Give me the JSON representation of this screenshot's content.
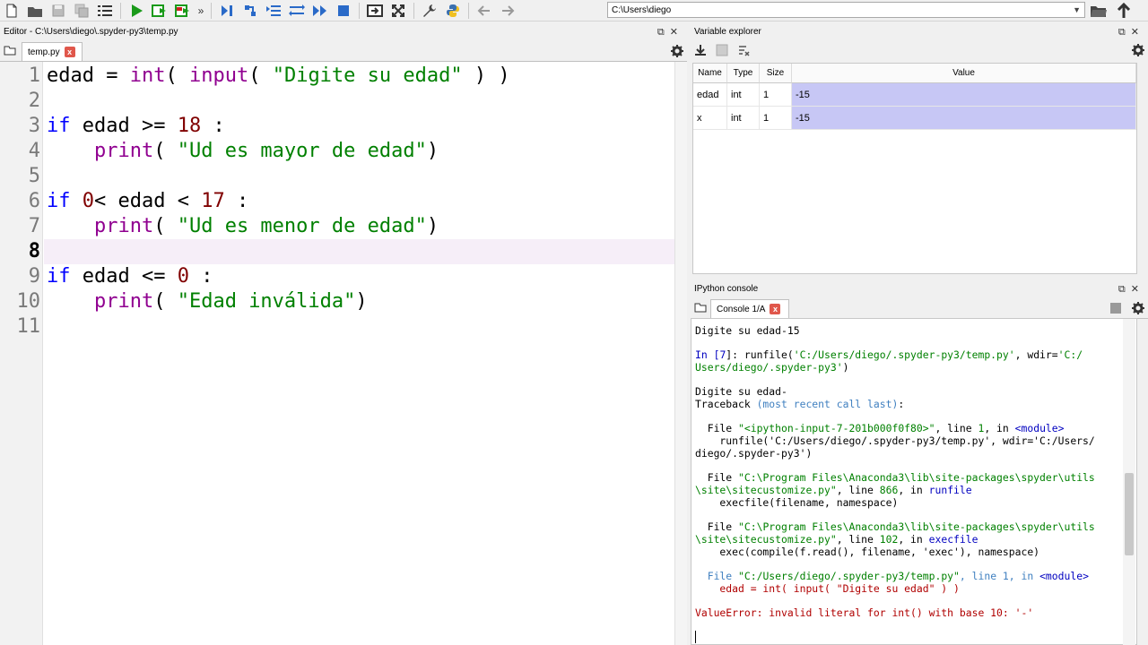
{
  "toolbar": {
    "path": "C:\\Users\\diego",
    "more": "»"
  },
  "editor": {
    "title": "Editor - C:\\Users\\diego\\.spyder-py3\\temp.py",
    "tab_label": "temp.py",
    "tab_close": "x",
    "line_numbers": [
      "1",
      "2",
      "3",
      "4",
      "5",
      "6",
      "7",
      "8",
      "9",
      "10",
      "11"
    ],
    "current_line": "8",
    "code": {
      "l1_a": "edad = ",
      "l1_int": "int",
      "l1_b": "( ",
      "l1_input": "input",
      "l1_c": "( ",
      "l1_str": "\"Digite su edad\"",
      "l1_d": " ) )",
      "l3_if": "if",
      "l3_a": " edad >= ",
      "l3_num": "18",
      "l3_b": " :",
      "l4_ind": "    ",
      "l4_print": "print",
      "l4_a": "( ",
      "l4_str": "\"Ud es mayor de edad\"",
      "l4_b": ")",
      "l6_if": "if",
      "l6_a": " ",
      "l6_num0": "0",
      "l6_b": "< edad < ",
      "l6_num": "17",
      "l6_c": " :",
      "l7_ind": "    ",
      "l7_print": "print",
      "l7_a": "( ",
      "l7_str": "\"Ud es menor de edad\"",
      "l7_b": ")",
      "l9_if": "if",
      "l9_a": " edad <= ",
      "l9_num": "0",
      "l9_b": " :",
      "l10_ind": "    ",
      "l10_print": "print",
      "l10_a": "( ",
      "l10_str": "\"Edad inválida\"",
      "l10_b": ")"
    }
  },
  "variable_explorer": {
    "title": "Variable explorer",
    "columns": [
      "Name",
      "Type",
      "Size",
      "Value"
    ],
    "rows": [
      {
        "name": "edad",
        "type": "int",
        "size": "1",
        "value": "-15"
      },
      {
        "name": "x",
        "type": "int",
        "size": "1",
        "value": "-15"
      }
    ],
    "highlight_color": "#c7c7f5"
  },
  "console": {
    "title": "IPython console",
    "tab_label": "Console 1/A",
    "tab_close": "x",
    "lines": {
      "a1": "Digite su edad-15",
      "b1_in": "In [",
      "b1_n": "7",
      "b1_c": "]: runfile(",
      "b1_s1": "'C:/Users/diego/.spyder-py3/temp.py'",
      "b1_m": ", wdir=",
      "b1_s2": "'C:/",
      "b2": "Users/diego/.spyder-py3'",
      "b2_end": ")",
      "c1": "Digite su edad-",
      "c2_a": "Traceback ",
      "c2_b": "(most recent call last)",
      "c2_c": ":",
      "d1_a": "  File ",
      "d1_s": "\"<ipython-input-7-201b000f0f80>\"",
      "d1_b": ", line ",
      "d1_n": "1",
      "d1_c": ", in ",
      "d1_m": "<module>",
      "d2": "    runfile('C:/Users/diego/.spyder-py3/temp.py', wdir='C:/Users/",
      "d3": "diego/.spyder-py3')",
      "e1_a": "  File ",
      "e1_s": "\"C:\\Program Files\\Anaconda3\\lib\\site-packages\\spyder\\utils",
      "e2_s": "\\site\\sitecustomize.py\"",
      "e2_b": ", line ",
      "e2_n": "866",
      "e2_c": ", in ",
      "e2_m": "runfile",
      "e3": "    execfile(filename, namespace)",
      "f1_a": "  File ",
      "f1_s": "\"C:\\Program Files\\Anaconda3\\lib\\site-packages\\spyder\\utils",
      "f2_s": "\\site\\sitecustomize.py\"",
      "f2_b": ", line ",
      "f2_n": "102",
      "f2_c": ", in ",
      "f2_m": "execfile",
      "f3": "    exec(compile(f.read(), filename, 'exec'), namespace)",
      "g1_a": "  File ",
      "g1_s": "\"C:/Users/diego/.spyder-py3/temp.py\"",
      "g1_b": ", line ",
      "g1_n": "1",
      "g1_c": ", in ",
      "g1_m": "<module>",
      "g2": "    edad = int( input( \"Digite su edad\" ) )",
      "h1": "ValueError: invalid literal for int() with base 10: '-'"
    }
  }
}
